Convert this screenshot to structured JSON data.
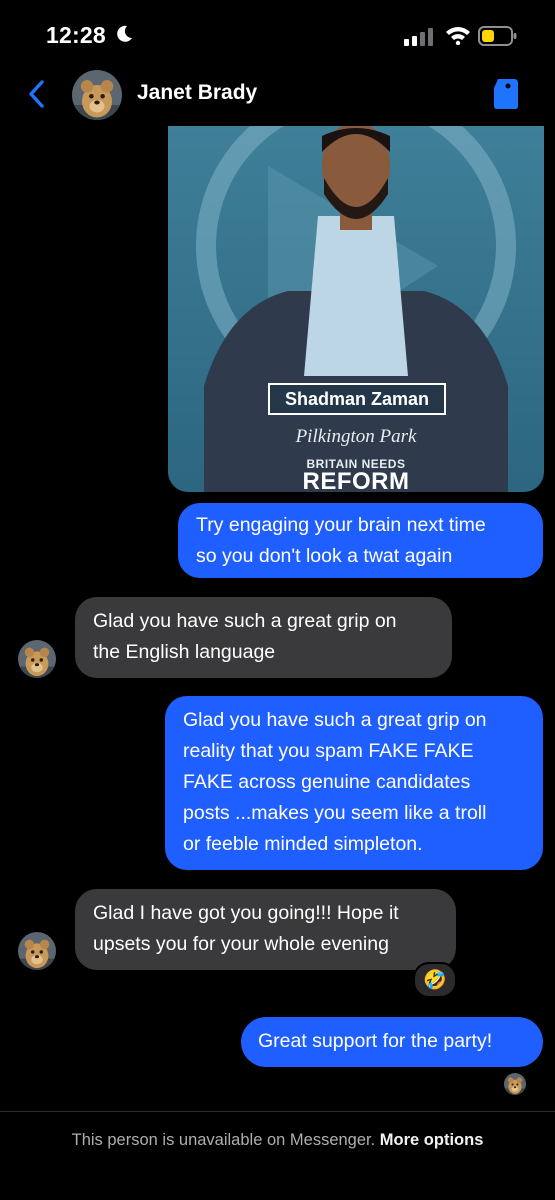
{
  "status_bar": {
    "time": "12:28",
    "icons": [
      "moon-icon",
      "cellular-signal-icon",
      "wifi-icon",
      "battery-low-icon"
    ],
    "battery_color": "#ffd60a"
  },
  "header": {
    "contact_name": "Janet Brady",
    "icons": [
      "back-chevron-icon",
      "tag-icon"
    ],
    "accent_color": "#1f74ff"
  },
  "shared_image": {
    "candidate_name": "Shadman Zaman",
    "place": "Pilkington Park",
    "party_line1": "BRITAIN NEEDS",
    "party_line2": "REFORM"
  },
  "messages": [
    {
      "from": "me",
      "lines": [
        "Try engaging your brain next time",
        "so you don't look a twat again"
      ]
    },
    {
      "from": "them",
      "lines": [
        "Glad you have such a great grip on",
        "the English language"
      ]
    },
    {
      "from": "me",
      "lines": [
        "Glad you have such a great grip on",
        "reality that you spam FAKE FAKE",
        "FAKE across genuine candidates",
        "posts ...makes you seem like a troll",
        "or feeble minded simpleton."
      ]
    },
    {
      "from": "them",
      "lines": [
        "Glad I have got you going!!! Hope it",
        "upsets you for your whole evening"
      ],
      "reaction": "🤣"
    },
    {
      "from": "me",
      "lines": [
        "Great support for the party!"
      ]
    }
  ],
  "footer": {
    "text": "This person is unavailable on Messenger.",
    "link": "More options"
  }
}
